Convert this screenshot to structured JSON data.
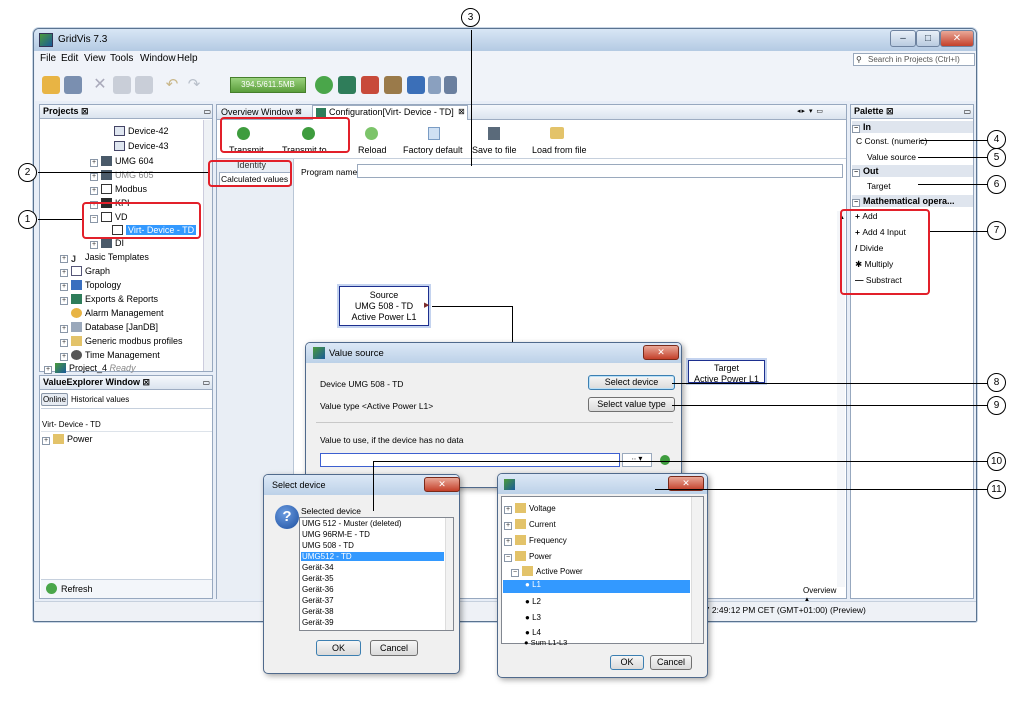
{
  "app": {
    "title": "GridVis 7.3",
    "memory": "394.5/611.5MB",
    "search_placeholder": "Search in Projects (Ctrl+I)",
    "project_status": "Ready"
  },
  "window_buttons": {
    "minimize": "–",
    "maximize": "□",
    "close": "✕"
  },
  "menu": [
    "File",
    "Edit",
    "View",
    "Tools",
    "Window",
    "Help"
  ],
  "projects": {
    "title": "Projects ⊠",
    "items": [
      {
        "label": "Device-42"
      },
      {
        "label": "Device-43"
      },
      {
        "label": "UMG 604"
      },
      {
        "label": "UMG 605"
      },
      {
        "label": "Modbus"
      },
      {
        "label": "KPI"
      },
      {
        "label": "VD"
      },
      {
        "label": "Virt- Device - TD"
      },
      {
        "label": "DI"
      },
      {
        "label": "Jasic Templates"
      },
      {
        "label": "Graph"
      },
      {
        "label": "Topology"
      },
      {
        "label": "Exports & Reports"
      },
      {
        "label": "Alarm Management"
      },
      {
        "label": "Database [JanDB]"
      },
      {
        "label": "Generic modbus profiles"
      },
      {
        "label": "Time Management"
      },
      {
        "label": "Project_4"
      }
    ]
  },
  "value_explorer": {
    "title": "ValueExplorer Window ⊠",
    "tab_online": "Online",
    "tab_historical": "Historical values",
    "device": "Virt- Device - TD",
    "folder": "Power",
    "refresh": "Refresh"
  },
  "editor": {
    "tab_overview": "Overview Window",
    "tab_config": "Configuration[Virt- Device - TD]",
    "toolbar": [
      "Transmit",
      "Transmit to ..",
      "Reload",
      "Factory default",
      "Save to file",
      "Load from file"
    ],
    "side_tabs": [
      "Identity",
      "Calculated values"
    ],
    "program_name_label": "Program name",
    "overview_label": "Overview ▲",
    "status": "17 2:49:12 PM CET (GMT+01:00)  (Preview)"
  },
  "canvas": {
    "source": [
      "Source",
      "UMG 508 - TD",
      "Active Power L1"
    ],
    "target": [
      "Target",
      "Active Power L1"
    ]
  },
  "palette": {
    "title": "Palette ⊠",
    "sections": [
      {
        "label": "In",
        "items": [
          "Const. (numeric)",
          "Value source"
        ]
      },
      {
        "label": "Out",
        "items": [
          "Target"
        ]
      },
      {
        "label": "Mathematical opera...",
        "items": [
          "Add",
          "Add 4 Input",
          "Divide",
          "Multiply",
          "Substract"
        ]
      }
    ]
  },
  "value_source_dialog": {
    "title": "Value source",
    "device": "Device  UMG 508 - TD",
    "select_device": "Select device",
    "value_type": "Value type  <Active Power L1>",
    "select_value_type": "Select value type",
    "no_data_label": "Value to use, if the device has no data",
    "dropdown": "∙∙ ▾"
  },
  "select_device_dialog": {
    "title": "Select device",
    "header": "Selected device",
    "devices": [
      "UMG 512 - Muster  (deleted)",
      "UMG 96RM-E - TD",
      "UMG 508 - TD",
      "UMG512 - TD",
      "Gerät-34",
      "Gerät-35",
      "Gerät-36",
      "Gerät-37",
      "Gerät-38",
      "Gerät-39"
    ],
    "selected_index": 3,
    "ok": "OK",
    "cancel": "Cancel"
  },
  "value_type_dialog": {
    "items": [
      "Voltage",
      "Current",
      "Frequency",
      "Power",
      "Active Power",
      "L1",
      "L2",
      "L3",
      "L4",
      "Sum L1-L3"
    ],
    "selected_index": 5,
    "ok": "OK",
    "cancel": "Cancel"
  },
  "callouts": [
    "1",
    "2",
    "3",
    "4",
    "5",
    "6",
    "7",
    "8",
    "9",
    "10",
    "11"
  ],
  "colors": {
    "accent": "#3399ff",
    "highlight": "#e2202a"
  }
}
